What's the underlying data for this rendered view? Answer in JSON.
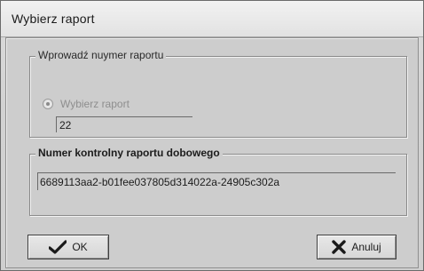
{
  "window": {
    "title": "Wybierz raport"
  },
  "group_report": {
    "legend": "Wprowadź nuymer raportu",
    "radio_label": "Wybierz raport",
    "value": "22"
  },
  "group_control": {
    "legend": "Numer kontrolny raportu dobowego",
    "value": "6689113aa2-b01fee037805d314022a-24905c302a"
  },
  "buttons": {
    "ok_label": "OK",
    "cancel_label": "Anuluj"
  },
  "icons": {
    "ok": "checkmark-icon",
    "cancel": "x-icon"
  }
}
